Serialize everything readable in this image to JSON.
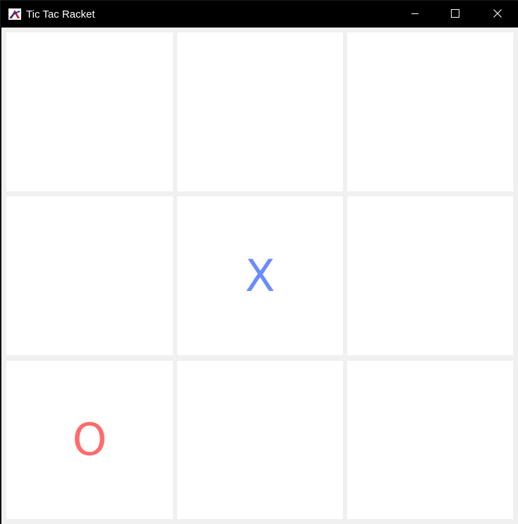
{
  "window": {
    "title": "Tic Tac Racket",
    "app_icon": "racket-logo-icon",
    "controls": {
      "minimize_icon": "minimize-icon",
      "maximize_icon": "maximize-icon",
      "close_icon": "close-icon"
    }
  },
  "colors": {
    "x": "#6b8cff",
    "o": "#ff6b6b",
    "grid": "#f0f0f0",
    "cell": "#ffffff"
  },
  "board": {
    "cells": [
      "",
      "",
      "",
      "",
      "X",
      "",
      "O",
      "",
      ""
    ]
  }
}
